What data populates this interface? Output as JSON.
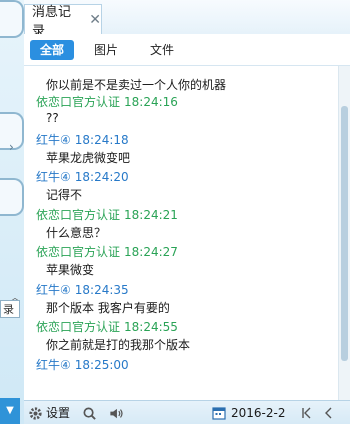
{
  "window": {
    "tab_title": "消息记录"
  },
  "filters": [
    {
      "label": "全部",
      "active": true
    },
    {
      "label": "图片",
      "active": false
    },
    {
      "label": "文件",
      "active": false
    }
  ],
  "messages": [
    {
      "sender": "",
      "time": "",
      "text": "你以前是不是卖过一个人你的机器",
      "type": "official"
    },
    {
      "sender": "依恋口官方认证",
      "time": "18:24:16",
      "text": "??",
      "type": "official"
    },
    {
      "sender": "红牛④",
      "time": "18:24:18",
      "text": "苹果龙虎微变吧",
      "type": "user"
    },
    {
      "sender": "红牛④",
      "time": "18:24:20",
      "text": "记得不",
      "type": "user"
    },
    {
      "sender": "依恋口官方认证",
      "time": "18:24:21",
      "text": "什么意思？",
      "type": "official"
    },
    {
      "sender": "依恋口官方认证",
      "time": "18:24:27",
      "text": "苹果微变",
      "type": "official"
    },
    {
      "sender": "红牛④",
      "time": "18:24:35",
      "text": "那个版本 我客户有要的",
      "type": "user"
    },
    {
      "sender": "依恋口官方认证",
      "time": "18:24:55",
      "text": "你之前就是打的我那个版本",
      "type": "official"
    },
    {
      "sender": "红牛④",
      "time": "18:25:00",
      "text": "",
      "type": "user"
    }
  ],
  "toolbar": {
    "settings_label": "设置",
    "date": "2016-2-2"
  },
  "left_strip": {
    "select_text": "录"
  },
  "colors": {
    "accent": "#2b8fe0",
    "user_name": "#2779c8",
    "official_name": "#2aa356"
  }
}
